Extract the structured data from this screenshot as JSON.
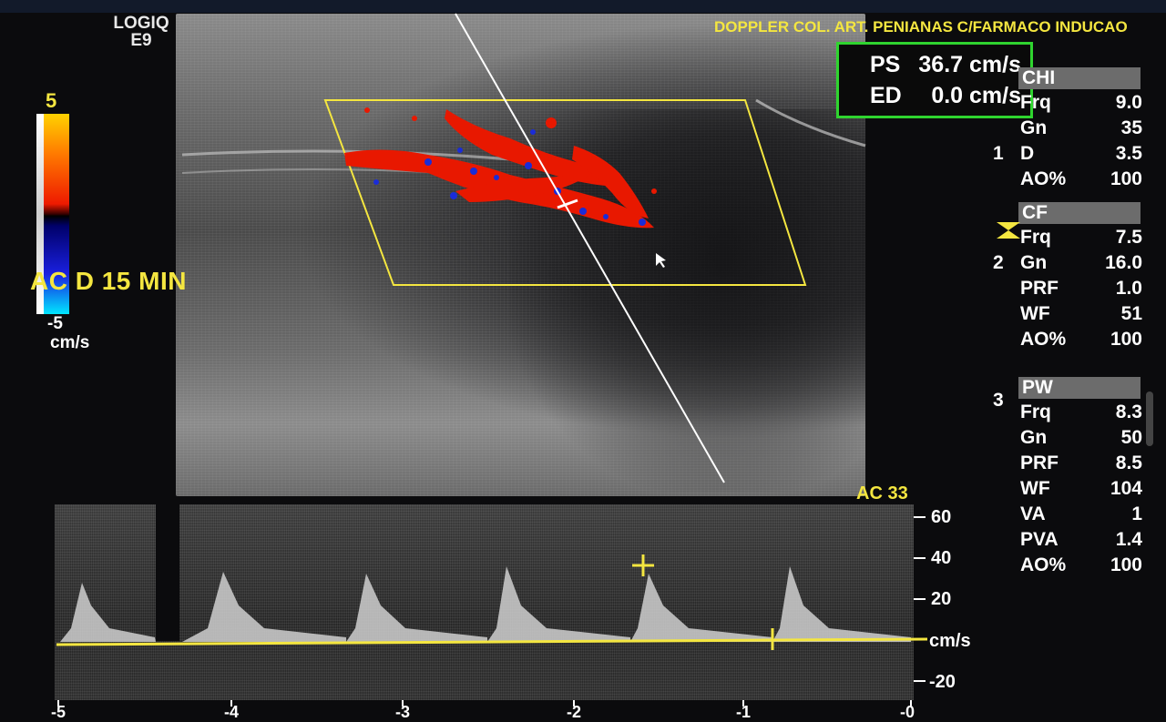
{
  "header": {
    "brand_line1": "LOGIQ",
    "brand_line2": "E9",
    "exam_title": "DOPPLER COL. ART. PENIANAS C/FARMACO INDUCAO"
  },
  "color_scale": {
    "max": "5",
    "min": "-5",
    "unit": "cm/s",
    "annotation": "AC D 15 MIN"
  },
  "measurement": {
    "ps_label": "PS",
    "ps_value": "36.7 cm/s",
    "ed_label": "ED",
    "ed_value": "0.0 cm/s"
  },
  "params": {
    "chi": {
      "title": "CHI",
      "rows": [
        {
          "k": "Frq",
          "v": "9.0"
        },
        {
          "k": "Gn",
          "v": "35"
        },
        {
          "k": "D",
          "v": "3.5"
        },
        {
          "k": "AO%",
          "v": "100"
        }
      ],
      "marker": "1"
    },
    "cf": {
      "title": "CF",
      "rows": [
        {
          "k": "Frq",
          "v": "7.5"
        },
        {
          "k": "Gn",
          "v": "16.0"
        },
        {
          "k": "PRF",
          "v": "1.0"
        },
        {
          "k": "WF",
          "v": "51"
        },
        {
          "k": "AO%",
          "v": "100"
        }
      ],
      "marker": "2"
    },
    "pw": {
      "title": "PW",
      "rows": [
        {
          "k": "Frq",
          "v": "8.3"
        },
        {
          "k": "Gn",
          "v": "50"
        },
        {
          "k": "PRF",
          "v": "8.5"
        },
        {
          "k": "WF",
          "v": "104"
        },
        {
          "k": "VA",
          "v": "1"
        },
        {
          "k": "PVA",
          "v": "1.4"
        },
        {
          "k": "AO%",
          "v": "100"
        }
      ],
      "marker": "3"
    }
  },
  "spectrum": {
    "label_ac": "AC 33",
    "y_unit": "cm/s",
    "y_ticks": [
      "60",
      "40",
      "20",
      "-20"
    ],
    "x_ticks": [
      "-5",
      "-4",
      "-3",
      "-2",
      "-1",
      "-0"
    ]
  },
  "colors": {
    "yellow": "#f4e640",
    "green_box": "#2fd42f",
    "doppler_red": "#e81800",
    "doppler_blue": "#1a2cd8"
  }
}
